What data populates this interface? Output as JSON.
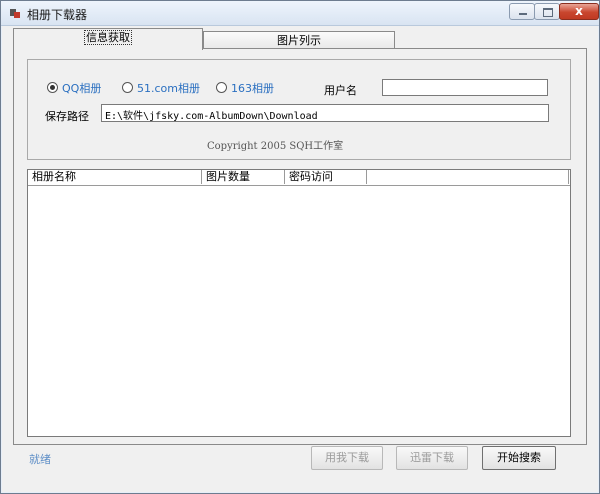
{
  "window": {
    "title": "相册下载器",
    "close_glyph": "x"
  },
  "tabs": [
    {
      "label": "信息获取"
    },
    {
      "label": "图片列示"
    }
  ],
  "form": {
    "radios": [
      {
        "label": "QQ相册",
        "selected": true
      },
      {
        "label": "51.com相册",
        "selected": false
      },
      {
        "label": "163相册",
        "selected": false
      }
    ],
    "username_label": "用户名",
    "username_value": "",
    "path_label": "保存路径",
    "path_value": "E:\\软件\\jfsky.com-AlbumDown\\Download",
    "copyright": "Copyright 2005  SQH工作室"
  },
  "list": {
    "columns": [
      "相册名称",
      "图片数量",
      "密码访问",
      ""
    ],
    "rows": []
  },
  "footer": {
    "status": "就绪",
    "btn_download_qq": "用我下载",
    "btn_xunlei": "迅雷下载",
    "btn_search": "开始搜索"
  },
  "colors": {
    "accent_text": "#2a6fc0",
    "status_text": "#5f8fc7",
    "close_button": "#c9462f"
  }
}
